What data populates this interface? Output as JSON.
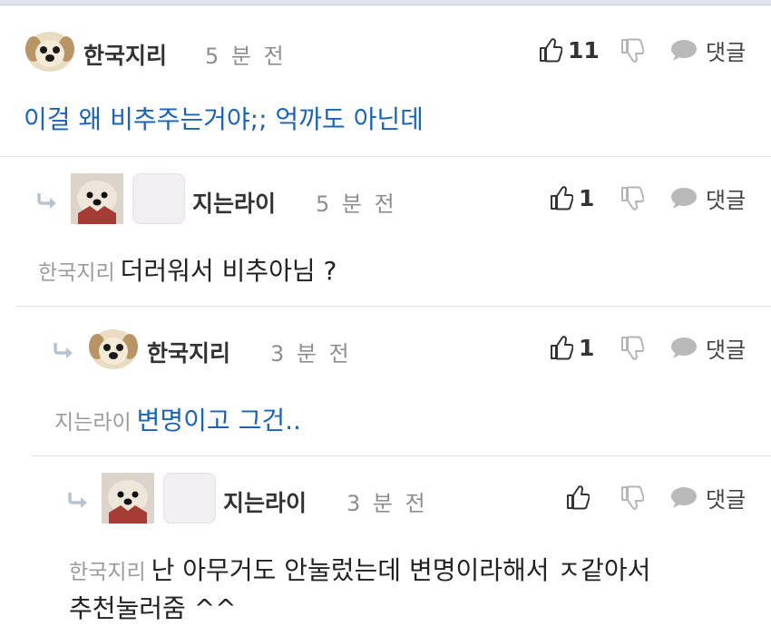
{
  "comments": [
    {
      "nickname": "한국지리",
      "time": "5 분 전",
      "likes": "11",
      "reply_label": "댓글",
      "mention": "",
      "text": "이걸 왜 비추주는거야;; 억까도 아닌데",
      "text_color": "#1a63b8"
    },
    {
      "nickname": "지는라이",
      "time": "5 분 전",
      "likes": "1",
      "reply_label": "댓글",
      "mention": "한국지리",
      "text": "더러워서 비추아님 ?",
      "text_color": "#222222"
    },
    {
      "nickname": "한국지리",
      "time": "3 분 전",
      "likes": "1",
      "reply_label": "댓글",
      "mention": "지는라이",
      "text": "변명이고 그건..",
      "text_color": "#1a63b8"
    },
    {
      "nickname": "지는라이",
      "time": "3 분 전",
      "likes": "",
      "reply_label": "댓글",
      "mention": "한국지리",
      "text_line1": "난 아무거도 안눌렀는데 변명이라해서 ㅈ같아서",
      "text_line2": "추천눌러줌 ^^",
      "text_color": "#222222"
    }
  ],
  "icons": {
    "like": "thumbs-up-icon",
    "dislike": "thumbs-down-icon",
    "reply": "speech-bubble-icon",
    "reply_arrow": "reply-arrow-icon"
  }
}
